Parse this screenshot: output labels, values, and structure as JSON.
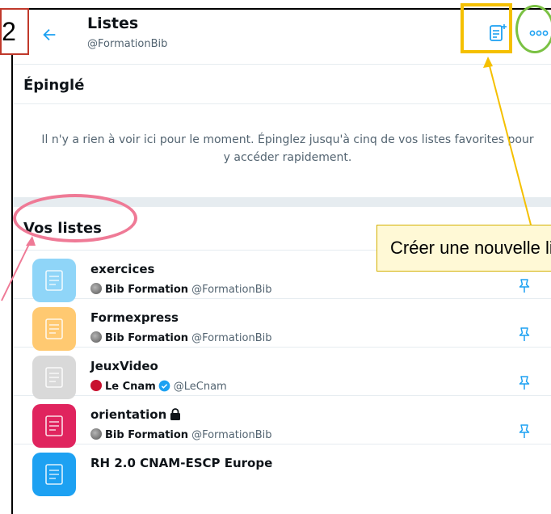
{
  "step_number": "2",
  "header": {
    "title": "Listes",
    "handle": "@FormationBib"
  },
  "pinned": {
    "title": "Épinglé",
    "empty_message": "Il n'y a rien à voir ici pour le moment. Épinglez jusqu'à cinq de vos listes favorites pour y accéder rapidement."
  },
  "your_lists": {
    "title": "Vos listes",
    "items": [
      {
        "name": "exercices",
        "owner": "Bib Formation",
        "handle": "@FormationBib",
        "color": "#8fd5f8",
        "owner_avatar": "globe",
        "verified": false,
        "private": false
      },
      {
        "name": "Formexpress",
        "owner": "Bib Formation",
        "handle": "@FormationBib",
        "color": "#ffc971",
        "owner_avatar": "globe",
        "verified": false,
        "private": false
      },
      {
        "name": "JeuxVideo",
        "owner": "Le Cnam",
        "handle": "@LeCnam",
        "color": "#d9d9d9",
        "owner_avatar": "cnam",
        "verified": true,
        "private": false
      },
      {
        "name": "orientation",
        "owner": "Bib Formation",
        "handle": "@FormationBib",
        "color": "#e0245e",
        "owner_avatar": "globe",
        "verified": false,
        "private": true
      },
      {
        "name": "RH 2.0 CNAM-ESCP Europe",
        "owner": "",
        "handle": "",
        "color": "#1da1f2",
        "owner_avatar": "",
        "verified": false,
        "private": false
      }
    ]
  },
  "tooltip": {
    "text": "Créer une nouvelle liste"
  },
  "colors": {
    "accent": "#1da1f2",
    "annotation_yellow": "#f5c000",
    "annotation_green": "#7ac143",
    "annotation_pink": "#ef7a96"
  },
  "icons": {
    "back": "arrow-left-icon",
    "new_list": "new-list-icon",
    "more": "more-dots-icon",
    "pin": "pin-icon",
    "lock": "lock-icon",
    "verified": "verified-badge-icon"
  }
}
